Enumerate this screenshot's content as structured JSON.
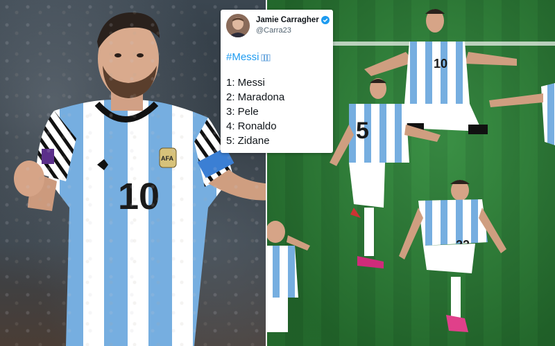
{
  "tweet": {
    "author_name": "Jamie Carragher",
    "handle": "@Carra23",
    "hashtag": "#Messi",
    "ranking": [
      {
        "text": "1: Messi"
      },
      {
        "text": "2: Maradona"
      },
      {
        "text": "3: Pele"
      },
      {
        "text": "4: Ronaldo"
      },
      {
        "text": "5: Zidane"
      }
    ],
    "verified_color": "#1d9bf0",
    "hashtag_color": "#1d9bf0"
  },
  "left_photo": {
    "player_number": "10",
    "captain_armband_color": "#3b7fd4"
  },
  "right_photo": {
    "players": [
      {
        "number": "10"
      },
      {
        "number": "5"
      },
      {
        "number": "22"
      }
    ],
    "kit_colors": {
      "stripe": "#76aee0",
      "base": "#ffffff",
      "shorts": "#ffffff",
      "pitch": "#2f8a3a"
    }
  }
}
